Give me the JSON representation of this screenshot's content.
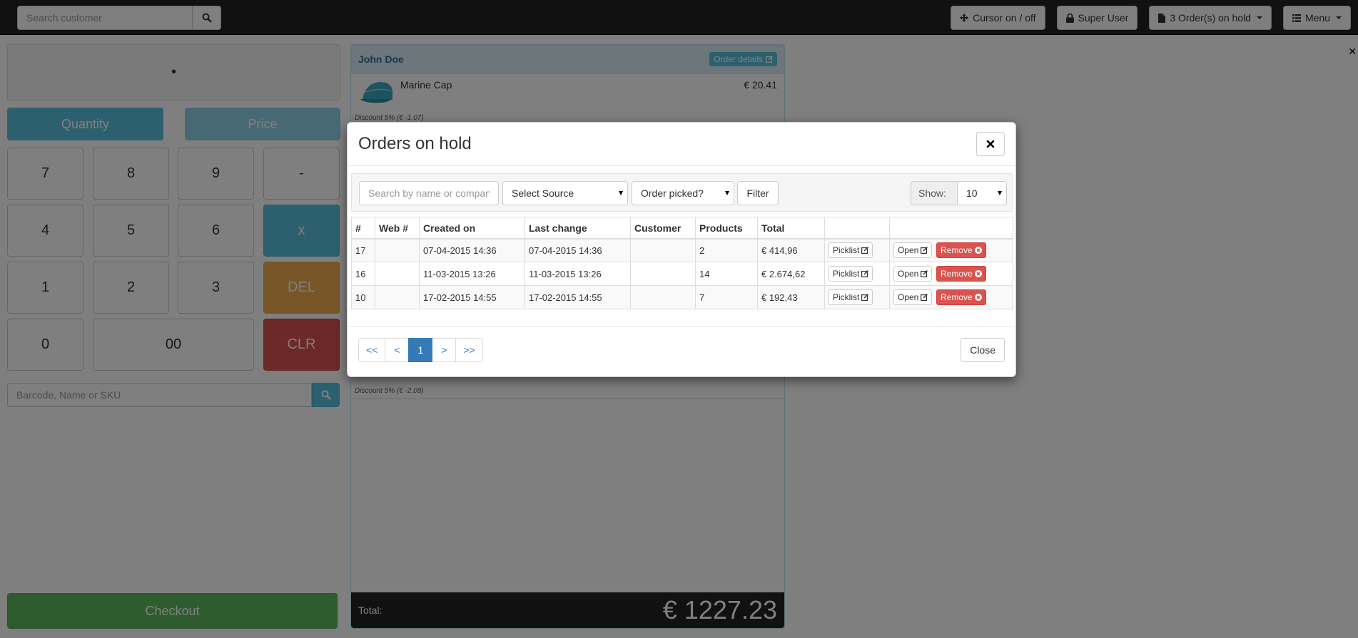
{
  "topbar": {
    "search_placeholder": "Search customer",
    "cursor_label": "Cursor on / off",
    "user_label": "Super User",
    "orders_on_hold_label": "3 Order(s) on hold",
    "menu_label": "Menu"
  },
  "keypad": {
    "display_value": "•",
    "quantity_label": "Quantity",
    "price_label": "Price",
    "keys": [
      "7",
      "8",
      "9",
      "-",
      "4",
      "5",
      "6",
      "x",
      "1",
      "2",
      "3",
      "DEL",
      "0",
      "00",
      "CLR"
    ],
    "barcode_placeholder": "Barcode, Name or SKU",
    "checkout_label": "Checkout"
  },
  "order": {
    "customer": "John Doe",
    "details_label": "Order details",
    "item_name": "Marine Cap",
    "item_price": "€ 20.41",
    "discount_top": "Discount 5% (€ -1.07)",
    "discount_bottom": "Discount 5% (€ -2.09)",
    "total_label": "Total:",
    "total_value": "€ 1227.23"
  },
  "modal": {
    "title": "Orders on hold",
    "search_placeholder": "Search by name or company",
    "source_select": "Select Source",
    "picked_select": "Order picked?",
    "filter_label": "Filter",
    "show_label": "Show:",
    "show_value": "10",
    "columns": [
      "#",
      "Web #",
      "Created on",
      "Last change",
      "Customer",
      "Products",
      "Total",
      "",
      ""
    ],
    "rows": [
      {
        "id": "17",
        "web": "",
        "created": "07-04-2015 14:36",
        "changed": "07-04-2015 14:36",
        "customer": "",
        "products": "2",
        "total": "€ 414,96"
      },
      {
        "id": "16",
        "web": "",
        "created": "11-03-2015 13:26",
        "changed": "11-03-2015 13:26",
        "customer": "",
        "products": "14",
        "total": "€ 2.674,62"
      },
      {
        "id": "10",
        "web": "",
        "created": "17-02-2015 14:55",
        "changed": "17-02-2015 14:55",
        "customer": "",
        "products": "7",
        "total": "€ 192,43"
      }
    ],
    "picklist_label": "Picklist",
    "open_label": "Open",
    "remove_label": "Remove",
    "pager": [
      "<<",
      "<",
      "1",
      ">",
      ">>"
    ],
    "close_label": "Close"
  },
  "colors": {
    "topbar": "#222222",
    "info": "#5bc0de",
    "warning": "#f0ad4e",
    "danger": "#d9534f",
    "success": "#5cb85c",
    "primary": "#337ab7"
  }
}
